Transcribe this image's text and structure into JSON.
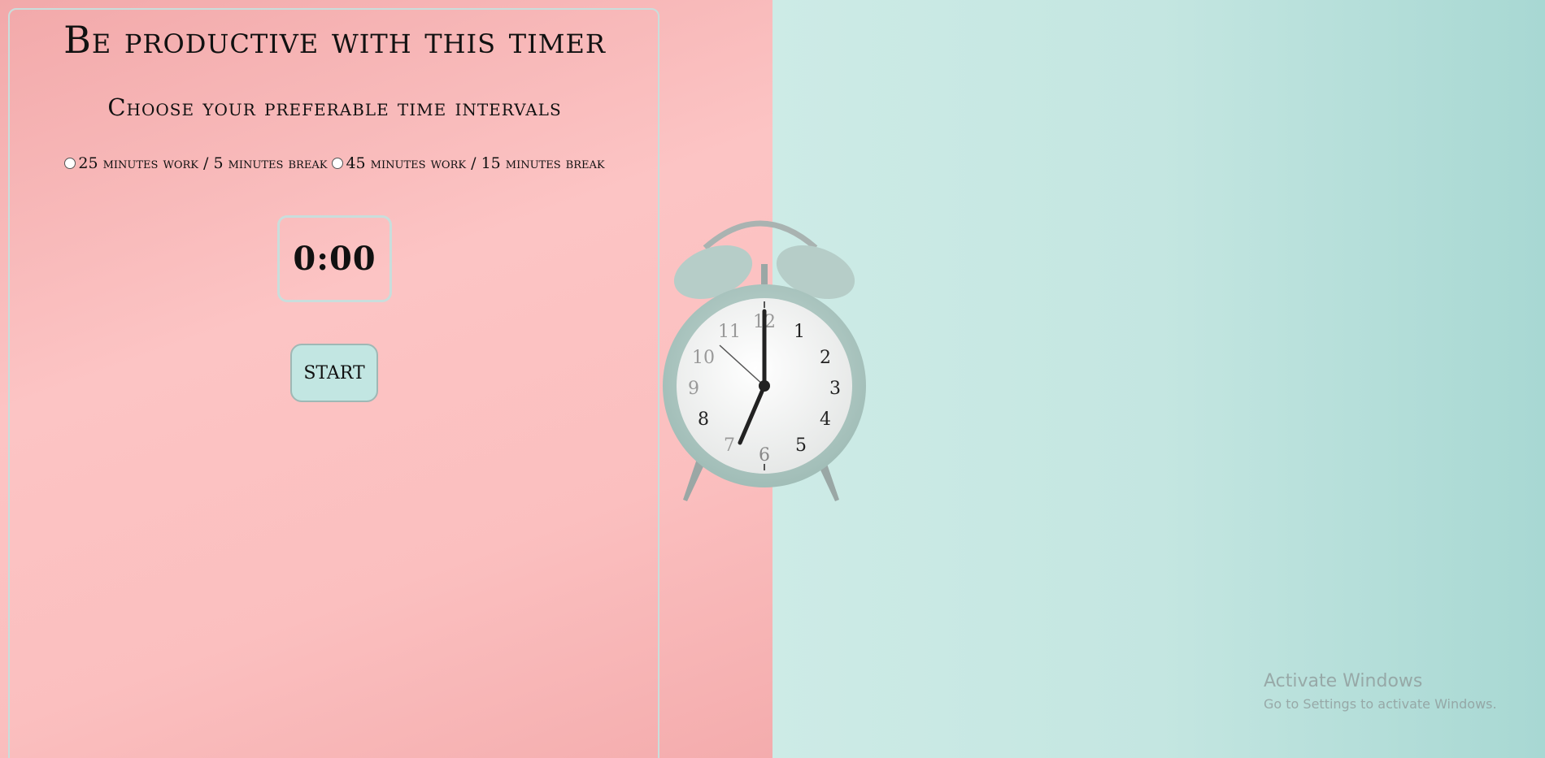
{
  "header": {
    "title": "Be productive with this timer",
    "subtitle": "Choose your preferable time intervals"
  },
  "interval_options": [
    {
      "label": "25 minutes work / 5 minutes break",
      "selected": false
    },
    {
      "label": "45 minutes work / 15 minutes break",
      "selected": false
    }
  ],
  "timer": {
    "display": "0:00"
  },
  "controls": {
    "start_label": "START"
  },
  "clock_face": {
    "numbers": [
      "12",
      "1",
      "2",
      "3",
      "4",
      "5",
      "6",
      "7",
      "8",
      "9",
      "10",
      "11"
    ]
  },
  "watermark": {
    "title": "Activate Windows",
    "subtitle": "Go to Settings to activate Windows."
  },
  "colors": {
    "left_bg": "#fcc4c4",
    "right_bg": "#c4e6e1",
    "button_bg": "#c2e6e2",
    "border": "#c9dedc"
  }
}
